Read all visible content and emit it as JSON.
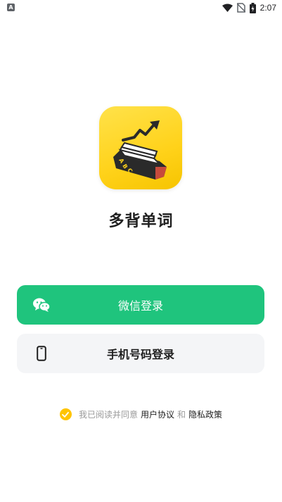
{
  "status_bar": {
    "time": "2:07",
    "left_icon": "android-notification-icon",
    "icons": [
      "wifi-icon",
      "no-sim-icon",
      "battery-icon"
    ]
  },
  "app": {
    "name": "多背单词",
    "logo_icon": "book-growth-logo",
    "logo_letters": [
      "A",
      "B",
      "C"
    ]
  },
  "buttons": {
    "wechat_label": "微信登录",
    "phone_label": "手机号码登录"
  },
  "agreement": {
    "prefix": "我已阅读并同意",
    "user_agreement": "用户协议",
    "and": "和",
    "privacy_policy": "隐私政策",
    "checked": true
  },
  "colors": {
    "wechat_green": "#1fc47d",
    "accent_yellow": "#ffc400",
    "button_gray": "#f4f5f7"
  }
}
